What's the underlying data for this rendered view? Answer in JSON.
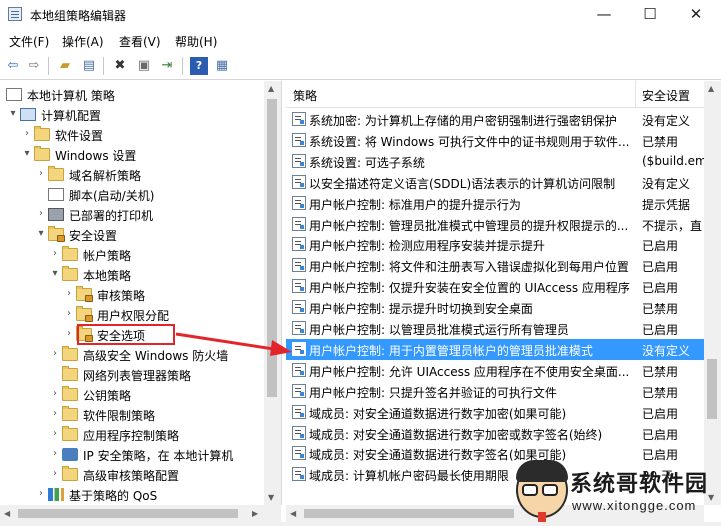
{
  "window": {
    "title": "本地组策略编辑器",
    "buttons": {
      "minimize": "—",
      "maximize": "☐",
      "close": "✕"
    }
  },
  "menu": {
    "items": [
      "文件(F)",
      "操作(A)",
      "查看(V)",
      "帮助(H)"
    ]
  },
  "toolbar": {
    "icons": [
      "back-arrow",
      "forward-arrow",
      "up-folder",
      "show-hide-tree",
      "delete",
      "properties",
      "export-list",
      "help",
      "view"
    ]
  },
  "tree": {
    "items": [
      {
        "label": "本地计算机 策略",
        "expander": "",
        "icon": "policy-doc"
      },
      {
        "label": "计算机配置",
        "expander": "▾",
        "icon": "computer"
      },
      {
        "label": "软件设置",
        "expander": "›",
        "icon": "folder"
      },
      {
        "label": "Windows 设置",
        "expander": "▾",
        "icon": "folder"
      },
      {
        "label": "域名解析策略",
        "expander": "›",
        "icon": "folder"
      },
      {
        "label": "脚本(启动/关机)",
        "expander": "",
        "icon": "script"
      },
      {
        "label": "已部署的打印机",
        "expander": "›",
        "icon": "printer"
      },
      {
        "label": "安全设置",
        "expander": "▾",
        "icon": "security-folder"
      },
      {
        "label": "帐户策略",
        "expander": "›",
        "icon": "folder"
      },
      {
        "label": "本地策略",
        "expander": "▾",
        "icon": "folder"
      },
      {
        "label": "审核策略",
        "expander": "›",
        "icon": "folder-lock"
      },
      {
        "label": "用户权限分配",
        "expander": "›",
        "icon": "folder-lock"
      },
      {
        "label": "安全选项",
        "expander": "›",
        "icon": "folder-lock"
      },
      {
        "label": "高级安全 Windows 防火墙",
        "expander": "›",
        "icon": "folder"
      },
      {
        "label": "网络列表管理器策略",
        "expander": "",
        "icon": "folder"
      },
      {
        "label": "公钥策略",
        "expander": "›",
        "icon": "folder"
      },
      {
        "label": "软件限制策略",
        "expander": "›",
        "icon": "folder"
      },
      {
        "label": "应用程序控制策略",
        "expander": "›",
        "icon": "folder"
      },
      {
        "label": "IP 安全策略，在 本地计算机",
        "expander": "›",
        "icon": "ip-security"
      },
      {
        "label": "高级审核策略配置",
        "expander": "›",
        "icon": "folder"
      },
      {
        "label": "基于策略的 QoS",
        "expander": "›",
        "icon": "qos-chart"
      }
    ]
  },
  "list": {
    "columns": [
      "策略",
      "安全设置"
    ],
    "rows": [
      {
        "policy": "系统加密: 为计算机上存储的用户密钥强制进行强密钥保护",
        "setting": "没有定义"
      },
      {
        "policy": "系统设置: 将 Windows 可执行文件中的证书规则用于软件...",
        "setting": "已禁用"
      },
      {
        "policy": "系统设置: 可选子系统",
        "setting": "($build.em"
      },
      {
        "policy": "以安全描述符定义语言(SDDL)语法表示的计算机访问限制",
        "setting": "没有定义"
      },
      {
        "policy": "用户帐户控制: 标准用户的提升提示行为",
        "setting": "提示凭据"
      },
      {
        "policy": "用户帐户控制: 管理员批准模式中管理员的提升权限提示的...",
        "setting": "不提示，直"
      },
      {
        "policy": "用户帐户控制: 检测应用程序安装并提示提升",
        "setting": "已启用"
      },
      {
        "policy": "用户帐户控制: 将文件和注册表写入错误虚拟化到每用户位置",
        "setting": "已启用"
      },
      {
        "policy": "用户帐户控制: 仅提升安装在安全位置的 UIAccess 应用程序",
        "setting": "已启用"
      },
      {
        "policy": "用户帐户控制: 提示提升时切换到安全桌面",
        "setting": "已禁用"
      },
      {
        "policy": "用户帐户控制: 以管理员批准模式运行所有管理员",
        "setting": "已启用"
      },
      {
        "policy": "用户帐户控制: 用于内置管理员帐户的管理员批准模式",
        "setting": "没有定义"
      },
      {
        "policy": "用户帐户控制: 允许 UIAccess 应用程序在不使用安全桌面...",
        "setting": "已禁用"
      },
      {
        "policy": "用户帐户控制: 只提升签名并验证的可执行文件",
        "setting": "已禁用"
      },
      {
        "policy": "域成员: 对安全通道数据进行数字加密(如果可能)",
        "setting": "已启用"
      },
      {
        "policy": "域成员: 对安全通道数据进行数字加密或数字签名(始终)",
        "setting": "已启用"
      },
      {
        "policy": "域成员: 对安全通道数据进行数字签名(如果可能)",
        "setting": "已启用"
      },
      {
        "policy": "域成员: 计算机帐户密码最长使用期限",
        "setting": "30 天"
      }
    ],
    "selected_index": 11
  },
  "watermark": {
    "title": "系统哥软件园",
    "url": "www.xitongge.com"
  },
  "colors": {
    "selection": "#3399ff",
    "highlight_box": "#e2252a",
    "arrow": "#e2252a"
  }
}
